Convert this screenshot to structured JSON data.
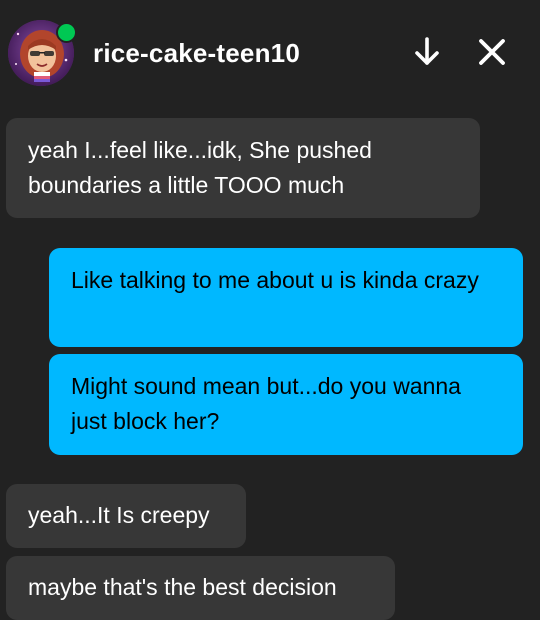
{
  "header": {
    "username": "rice-cake-teen10",
    "avatar_icon": "user-avatar-icon",
    "online_status_color": "#00c853",
    "scroll_down_icon": "arrow-down-icon",
    "close_icon": "close-icon"
  },
  "colors": {
    "background": "#222222",
    "received_bubble": "#373737",
    "sent_bubble": "#00b8ff"
  },
  "messages": [
    {
      "direction": "received",
      "text": "yeah I...feel like...idk, She pushed boundaries a little TOOO much"
    },
    {
      "direction": "sent",
      "text": "Like talking to me about u is kinda crazy"
    },
    {
      "direction": "sent",
      "text": "Might sound mean but...do you wanna just block her?"
    },
    {
      "direction": "received",
      "text": "yeah...It Is creepy"
    },
    {
      "direction": "received",
      "text": "maybe that's the best decision"
    }
  ]
}
